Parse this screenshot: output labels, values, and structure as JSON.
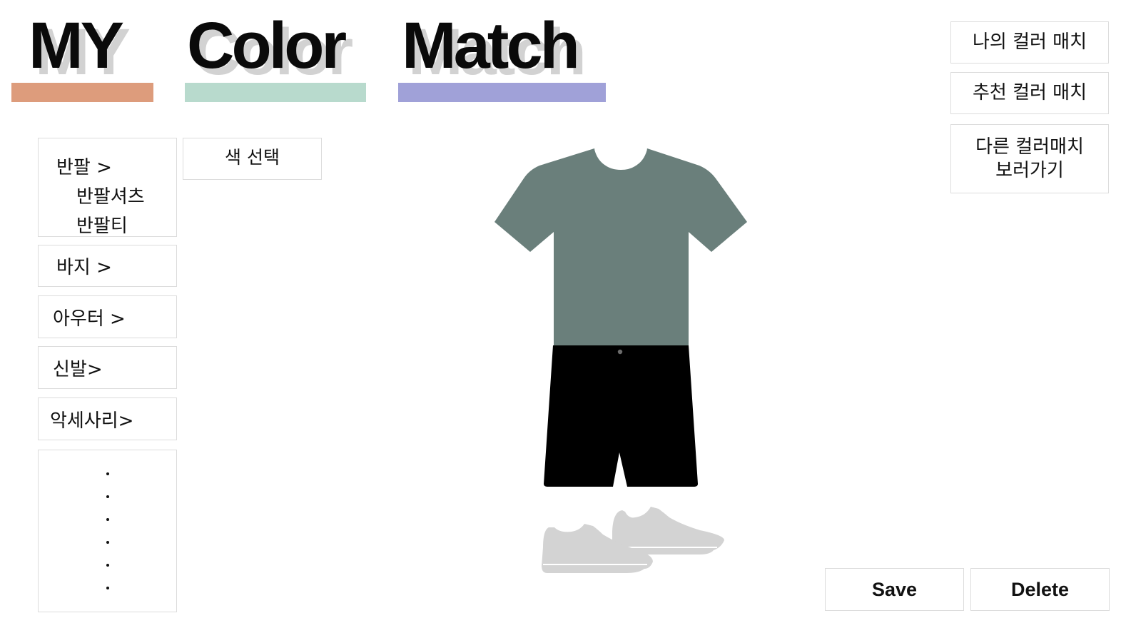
{
  "logo": {
    "words": [
      "MY",
      "Color",
      "Match"
    ],
    "colors": {
      "bar_my": "#dd9c7c",
      "bar_color": "#b8dacd",
      "bar_match": "#a0a1d8",
      "front": "#0a0a0a",
      "shadow": "#d2d2d2"
    }
  },
  "sidebar": {
    "items": [
      {
        "label": "반팔 >",
        "sub": [
          "반팔셔츠",
          "반팔티"
        ]
      },
      {
        "label": "바지 >"
      },
      {
        "label": "아우터 >"
      },
      {
        "label": "신발>"
      },
      {
        "label": "악세사리>"
      }
    ],
    "more_dots": 6
  },
  "color_picker": {
    "label": "색 선택"
  },
  "right_menu": {
    "my_match": "나의 컬러 매치",
    "recommended_match": "추천 컬러 매치",
    "other_match_line1": "다른 컬러매치",
    "other_match_line2": "보러가기"
  },
  "outfit": {
    "icons": [
      "tshirt-icon",
      "shorts-icon",
      "sneakers-icon"
    ],
    "colors": {
      "tshirt": "#6a7f7b",
      "shorts": "#000000",
      "shoes": "#d3d3d3"
    }
  },
  "actions": {
    "save": "Save",
    "delete": "Delete"
  }
}
